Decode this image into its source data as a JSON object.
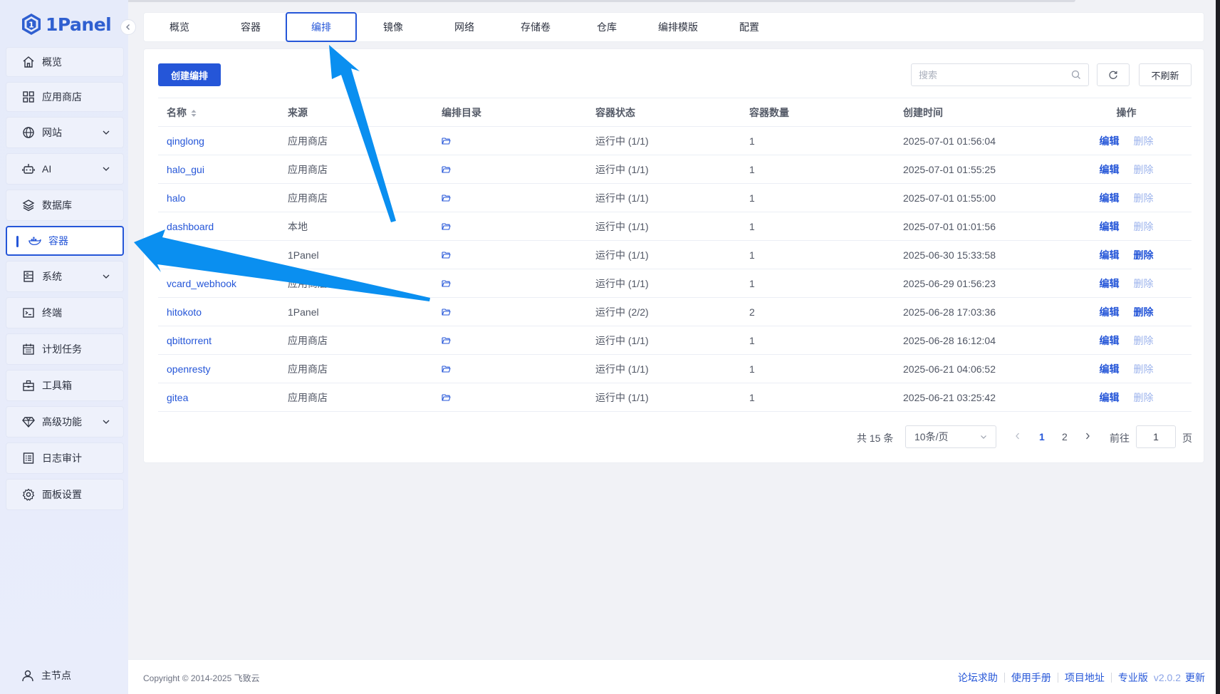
{
  "app": {
    "logo_text": "1Panel"
  },
  "sidebar": {
    "items": [
      {
        "label": "概览",
        "icon": "home-icon"
      },
      {
        "label": "应用商店",
        "icon": "grid-icon"
      },
      {
        "label": "网站",
        "icon": "globe-icon",
        "expandable": true
      },
      {
        "label": "AI",
        "icon": "robot-icon",
        "expandable": true
      },
      {
        "label": "数据库",
        "icon": "layers-icon"
      },
      {
        "label": "容器",
        "icon": "docker-icon",
        "active": true
      },
      {
        "label": "系统",
        "icon": "server-icon",
        "expandable": true
      },
      {
        "label": "终端",
        "icon": "terminal-icon"
      },
      {
        "label": "计划任务",
        "icon": "calendar-icon"
      },
      {
        "label": "工具箱",
        "icon": "toolbox-icon"
      },
      {
        "label": "高级功能",
        "icon": "diamond-icon",
        "expandable": true
      },
      {
        "label": "日志审计",
        "icon": "log-icon"
      },
      {
        "label": "面板设置",
        "icon": "gear-icon"
      }
    ],
    "footer_label": "主节点"
  },
  "tabs": [
    {
      "label": "概览"
    },
    {
      "label": "容器"
    },
    {
      "label": "编排",
      "active": true
    },
    {
      "label": "镜像"
    },
    {
      "label": "网络"
    },
    {
      "label": "存储卷"
    },
    {
      "label": "仓库"
    },
    {
      "label": "编排模版"
    },
    {
      "label": "配置"
    }
  ],
  "toolbar": {
    "create_label": "创建编排",
    "search_placeholder": "搜索",
    "no_refresh_label": "不刷新"
  },
  "table": {
    "headers": {
      "name": "名称",
      "source": "来源",
      "dir": "编排目录",
      "status": "容器状态",
      "count": "容器数量",
      "created": "创建时间",
      "ops": "操作"
    },
    "edit_label": "编辑",
    "delete_label": "删除",
    "rows": [
      {
        "name": "qinglong",
        "source": "应用商店",
        "status": "运行中 (1/1)",
        "count": "1",
        "created": "2025-07-01 01:56:04",
        "delete_enabled": false
      },
      {
        "name": "halo_gui",
        "source": "应用商店",
        "status": "运行中 (1/1)",
        "count": "1",
        "created": "2025-07-01 01:55:25",
        "delete_enabled": false
      },
      {
        "name": "halo",
        "source": "应用商店",
        "status": "运行中 (1/1)",
        "count": "1",
        "created": "2025-07-01 01:55:00",
        "delete_enabled": false
      },
      {
        "name": "dashboard",
        "source": "本地",
        "status": "运行中 (1/1)",
        "count": "1",
        "created": "2025-07-01 01:01:56",
        "delete_enabled": false
      },
      {
        "name": "",
        "source": "1Panel",
        "status": "运行中 (1/1)",
        "count": "1",
        "created": "2025-06-30 15:33:58",
        "delete_enabled": true
      },
      {
        "name": "vcard_webhook",
        "source": "应用商店",
        "status": "运行中 (1/1)",
        "count": "1",
        "created": "2025-06-29 01:56:23",
        "delete_enabled": false
      },
      {
        "name": "hitokoto",
        "source": "1Panel",
        "status": "运行中 (2/2)",
        "count": "2",
        "created": "2025-06-28 17:03:36",
        "delete_enabled": true
      },
      {
        "name": "qbittorrent",
        "source": "应用商店",
        "status": "运行中 (1/1)",
        "count": "1",
        "created": "2025-06-28 16:12:04",
        "delete_enabled": false
      },
      {
        "name": "openresty",
        "source": "应用商店",
        "status": "运行中 (1/1)",
        "count": "1",
        "created": "2025-06-21 04:06:52",
        "delete_enabled": false
      },
      {
        "name": "gitea",
        "source": "应用商店",
        "status": "运行中 (1/1)",
        "count": "1",
        "created": "2025-06-21 03:25:42",
        "delete_enabled": false
      }
    ]
  },
  "pagination": {
    "total_text": "共 15 条",
    "page_size_text": "10条/页",
    "pages": [
      "1",
      "2"
    ],
    "current_page": "1",
    "goto_label": "前往",
    "goto_value": "1",
    "page_unit": "页"
  },
  "footer": {
    "copyright": "Copyright © 2014-2025 飞致云",
    "links": [
      "论坛求助",
      "使用手册",
      "项目地址",
      "专业版"
    ],
    "version": "v2.0.2",
    "update_label": "更新"
  },
  "colors": {
    "accent": "#2556d8",
    "arrow": "#0a8ff0"
  }
}
